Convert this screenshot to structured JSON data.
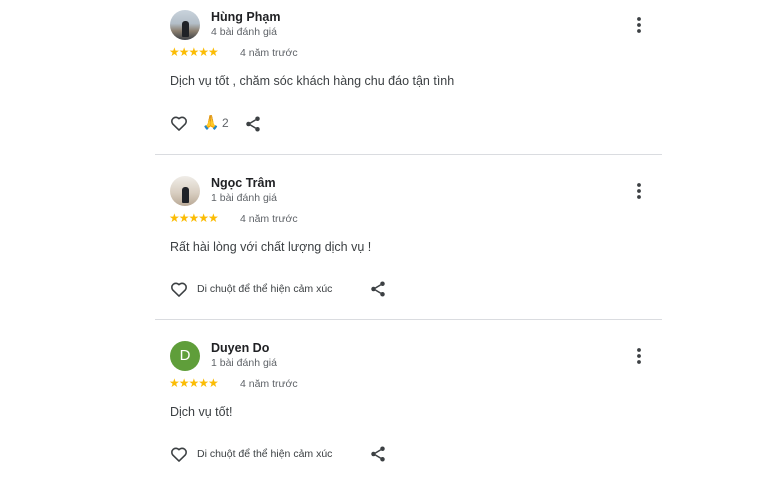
{
  "reviews": [
    {
      "avatar_letter": "",
      "name": "Hùng Phạm",
      "review_count": "4 bài đánh giá",
      "rating": 5,
      "stars": "★★★★★",
      "time": "4 năm trước",
      "text": "Dịch vụ tốt , chăm sóc khách hàng chu đáo tận tình",
      "reaction_emoji": "🙏",
      "reaction_count": "2",
      "hint": ""
    },
    {
      "avatar_letter": "",
      "name": "Ngọc Trâm",
      "review_count": "1 bài đánh giá",
      "rating": 5,
      "stars": "★★★★★",
      "time": "4 năm trước",
      "text": "Rất hài lòng với chất lượng dịch vụ !",
      "reaction_emoji": "",
      "reaction_count": "",
      "hint": "Di chuột để thể hiện cảm xúc"
    },
    {
      "avatar_letter": "D",
      "name": "Duyen Do",
      "review_count": "1 bài đánh giá",
      "rating": 5,
      "stars": "★★★★★",
      "time": "4 năm trước",
      "text": "Dịch vụ tốt!",
      "reaction_emoji": "",
      "reaction_count": "",
      "hint": "Di chuột để thể hiện cảm xúc"
    }
  ],
  "colors": {
    "star": "#fbbc04",
    "avatar_green": "#5f9e3a",
    "divider": "#dadce0"
  },
  "icons": [
    "more-vert-icon",
    "heart-outline-icon",
    "share-icon",
    "folded-hands-emoji"
  ]
}
